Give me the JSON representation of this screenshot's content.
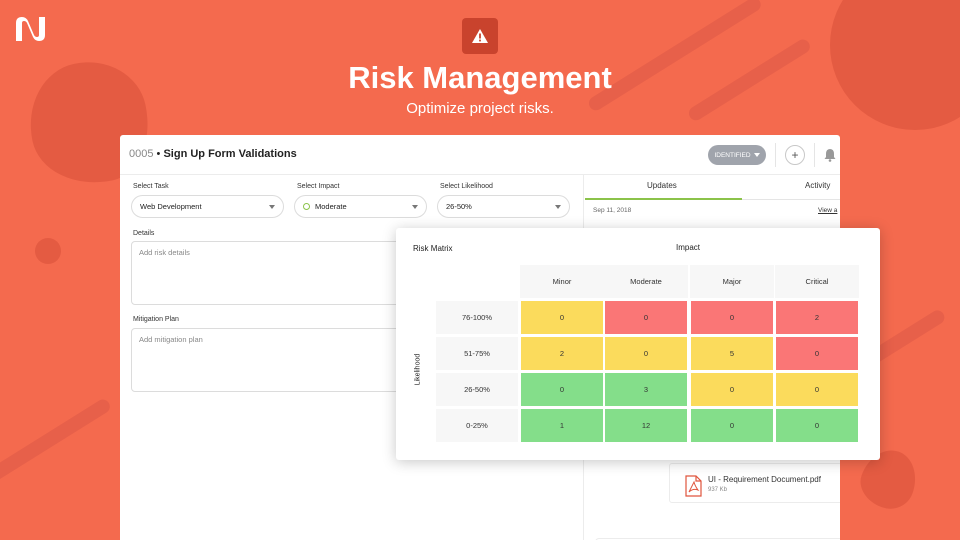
{
  "colors": {
    "background": "#f46a4e",
    "accent": "#8bc34a",
    "risk_high": "#fa7676",
    "risk_medium": "#fbdb5c",
    "risk_low": "#84de8a"
  },
  "hero": {
    "icon": "warning-icon",
    "title": "Risk Management",
    "subtitle": "Optimize project risks."
  },
  "card": {
    "task_number": "0005",
    "task_separator": "•",
    "task_name": "Sign Up Form Validations",
    "status_label": "IDENTIFIED",
    "add_icon": "+",
    "form": {
      "task_label": "Select Task",
      "task_value": "Web Development",
      "impact_label": "Select Impact",
      "impact_value": "Moderate",
      "likelihood_label": "Select Likelihood",
      "likelihood_value": "26-50%",
      "details_label": "Details",
      "details_placeholder": "Add risk details",
      "mitigation_label": "Mitigation Plan",
      "mitigation_placeholder": "Add mitigation plan"
    },
    "tabs": [
      {
        "label": "Updates",
        "active": true
      },
      {
        "label": "Activity",
        "active": false
      }
    ],
    "update_date": "Sep 11, 2018",
    "view_link": "View a",
    "attachment": {
      "name": "UI - Requirement Document.pdf",
      "size": "937 Kb"
    }
  },
  "matrix": {
    "title": "Risk Matrix",
    "impact_title": "Impact",
    "likelihood_title": "Likelihood",
    "impact_levels": [
      "Minor",
      "Moderate",
      "Major",
      "Critical"
    ],
    "rows": [
      {
        "label": "76-100%",
        "values": [
          "0",
          "0",
          "0",
          "2"
        ],
        "levels": [
          "medium",
          "high",
          "high",
          "high"
        ]
      },
      {
        "label": "51-75%",
        "values": [
          "2",
          "0",
          "5",
          "0"
        ],
        "levels": [
          "medium",
          "medium",
          "medium",
          "high"
        ]
      },
      {
        "label": "26-50%",
        "values": [
          "0",
          "3",
          "0",
          "0"
        ],
        "levels": [
          "low",
          "low",
          "medium",
          "medium"
        ]
      },
      {
        "label": "0-25%",
        "values": [
          "1",
          "12",
          "0",
          "0"
        ],
        "levels": [
          "low",
          "low",
          "low",
          "low"
        ]
      }
    ]
  }
}
